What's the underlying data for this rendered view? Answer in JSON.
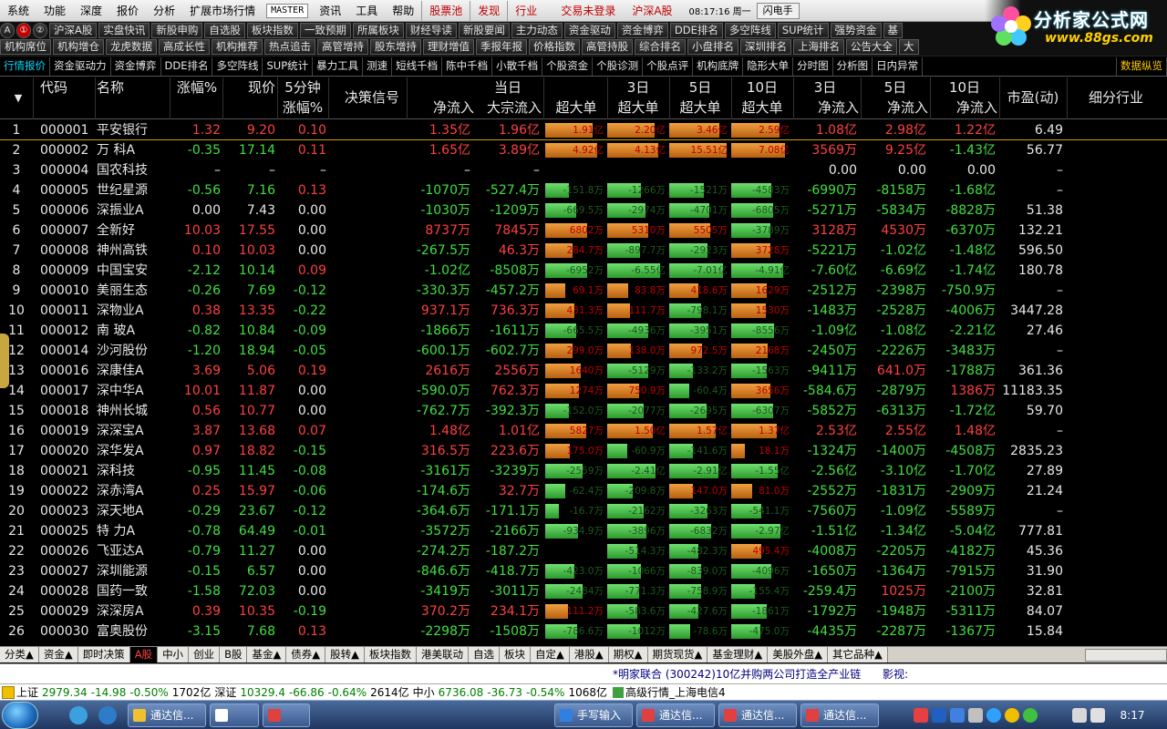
{
  "menubar": {
    "items": [
      "系统",
      "功能",
      "深度",
      "报价",
      "分析",
      "扩展市场行情"
    ],
    "master": "MASTER",
    "items2": [
      "资讯",
      "工具",
      "帮助"
    ],
    "items3": [
      "股票池",
      "发现",
      "行业"
    ],
    "status": "交易未登录",
    "market": "沪深A股",
    "time": "08:17:16 周一",
    "flash": "闪电手"
  },
  "logo": {
    "title": "分析家公式网",
    "url": "www.88gs.com"
  },
  "toolbar1": [
    "A",
    "①",
    "②",
    "沪深A股",
    "实盘快讯",
    "新股申购",
    "自选股",
    "板块指数",
    "一致预期",
    "所属板块",
    "财经导读",
    "新股要闻",
    "主力动态",
    "资金驱动",
    "资金博弈",
    "DDE排名",
    "多空阵线",
    "SUP统计",
    "强势资金",
    "基"
  ],
  "toolbar2": [
    "机构席位",
    "机构增仓",
    "龙虎数据",
    "高成长性",
    "机构推荐",
    "热点追击",
    "高管增持",
    "股东增持",
    "理财增值",
    "季报年报",
    "价格指数",
    "高管持股",
    "综合排名",
    "小盘排名",
    "深圳排名",
    "上海排名",
    "公告大全",
    "大"
  ],
  "tabs": [
    "行情报价",
    "资金驱动力",
    "资金博弈",
    "DDE排名",
    "多空阵线",
    "SUP统计",
    "暴力工具",
    "测速",
    "短线千档",
    "陈中千档",
    "小散千档",
    "个股资金",
    "个股诊测",
    "个股点评",
    "机构底牌",
    "隐形大单",
    "分时图",
    "分析图",
    "日内异常"
  ],
  "tabs_right": "数据纵览",
  "headers": {
    "code": "代码",
    "name": "名称",
    "pct": "涨幅%",
    "price": "现价",
    "m5a": "5分钟",
    "m5b": "涨幅%",
    "signal": "决策信号",
    "today": "当日",
    "net": "净流入",
    "block": "大宗流入",
    "super": "超大单",
    "d3": "3日",
    "d5": "5日",
    "d10": "10日",
    "pe": "市盈(动)",
    "industry": "细分行业"
  },
  "rows": [
    {
      "i": "1",
      "code": "000001",
      "name": "平安银行",
      "pct": "1.32",
      "price": "9.20",
      "m5": "0.10",
      "net": "1.35亿",
      "blk": "1.96亿",
      "s1": "1.91亿",
      "s3": "2.20亿",
      "s5": "3.46亿",
      "s10": "2.59亿",
      "n3": "1.08亿",
      "n5": "2.98亿",
      "n10": "1.22亿",
      "pe": "6.49"
    },
    {
      "i": "2",
      "code": "000002",
      "name": "万 科A",
      "pct": "-0.35",
      "price": "17.14",
      "m5": "0.11",
      "net": "1.65亿",
      "blk": "3.89亿",
      "s1": "4.92亿",
      "s3": "4.13亿",
      "s5": "15.51亿",
      "s10": "7.08亿",
      "n3": "3569万",
      "n5": "9.25亿",
      "n10": "-1.43亿",
      "pe": "56.77"
    },
    {
      "i": "3",
      "code": "000004",
      "name": "国农科技",
      "pct": "–",
      "price": "–",
      "m5": "–",
      "net": "–",
      "blk": "–",
      "s1": "",
      "s3": "",
      "s5": "",
      "s10": "",
      "n3": "0.00",
      "n5": "0.00",
      "n10": "0.00",
      "pe": "–"
    },
    {
      "i": "4",
      "code": "000005",
      "name": "世纪星源",
      "pct": "-0.56",
      "price": "7.16",
      "m5": "0.13",
      "net": "-1070万",
      "blk": "-527.4万",
      "s1": "-151.8万",
      "s3": "-1266万",
      "s5": "-1521万",
      "s10": "-4583万",
      "n3": "-6990万",
      "n5": "-8158万",
      "n10": "-1.68亿",
      "pe": "–"
    },
    {
      "i": "5",
      "code": "000006",
      "name": "深振业A",
      "pct": "0.00",
      "price": "7.43",
      "m5": "0.00",
      "net": "-1030万",
      "blk": "-1209万",
      "s1": "-669.5万",
      "s3": "-2974万",
      "s5": "-4701万",
      "s10": "-6805万",
      "n3": "-5271万",
      "n5": "-5834万",
      "n10": "-8828万",
      "pe": "51.38"
    },
    {
      "i": "6",
      "code": "000007",
      "name": "全新好",
      "pct": "10.03",
      "price": "17.55",
      "m5": "0.00",
      "net": "8737万",
      "blk": "7845万",
      "s1": "6802万",
      "s3": "5310万",
      "s5": "5505万",
      "s10": "-3789万",
      "n3": "3128万",
      "n5": "4530万",
      "n10": "-6370万",
      "pe": "132.21"
    },
    {
      "i": "7",
      "code": "000008",
      "name": "神州高铁",
      "pct": "0.10",
      "price": "10.03",
      "m5": "0.00",
      "net": "-267.5万",
      "blk": "46.3万",
      "s1": "284.7万",
      "s3": "-897.7万",
      "s5": "-2923万",
      "s10": "3728万",
      "n3": "-5221万",
      "n5": "-1.02亿",
      "n10": "-1.48亿",
      "pe": "596.50"
    },
    {
      "i": "8",
      "code": "000009",
      "name": "中国宝安",
      "pct": "-2.12",
      "price": "10.14",
      "m5": "0.09",
      "net": "-1.02亿",
      "blk": "-8508万",
      "s1": "-6952万",
      "s3": "-6.55亿",
      "s5": "-7.01亿",
      "s10": "-4.91亿",
      "n3": "-7.60亿",
      "n5": "-6.69亿",
      "n10": "-1.74亿",
      "pe": "180.78"
    },
    {
      "i": "9",
      "code": "000010",
      "name": "美丽生态",
      "pct": "-0.26",
      "price": "7.69",
      "m5": "-0.12",
      "net": "-330.3万",
      "blk": "-457.2万",
      "s1": "69.1万",
      "s3": "83.8万",
      "s5": "418.6万",
      "s10": "1629万",
      "n3": "-2512万",
      "n5": "-2398万",
      "n10": "-750.9万",
      "pe": "–"
    },
    {
      "i": "10",
      "code": "000011",
      "name": "深物业A",
      "pct": "0.38",
      "price": "13.35",
      "m5": "-0.22",
      "net": "937.1万",
      "blk": "736.3万",
      "s1": "431.3万",
      "s3": "111.7万",
      "s5": "-798.1万",
      "s10": "1530万",
      "n3": "-1483万",
      "n5": "-2528万",
      "n10": "-4006万",
      "pe": "3447.28"
    },
    {
      "i": "11",
      "code": "000012",
      "name": "南 玻A",
      "pct": "-0.82",
      "price": "10.84",
      "m5": "-0.09",
      "net": "-1866万",
      "blk": "-1611万",
      "s1": "-665.5万",
      "s3": "-4936万",
      "s5": "-3951万",
      "s10": "-8556万",
      "n3": "-1.09亿",
      "n5": "-1.08亿",
      "n10": "-2.21亿",
      "pe": "27.46"
    },
    {
      "i": "12",
      "code": "000014",
      "name": "沙河股份",
      "pct": "-1.20",
      "price": "18.94",
      "m5": "-0.05",
      "net": "-600.1万",
      "blk": "-602.7万",
      "s1": "299.0万",
      "s3": "138.0万",
      "s5": "972.5万",
      "s10": "2168万",
      "n3": "-2450万",
      "n5": "-2226万",
      "n10": "-3483万",
      "pe": "–"
    },
    {
      "i": "13",
      "code": "000016",
      "name": "深康佳A",
      "pct": "3.69",
      "price": "5.06",
      "m5": "0.19",
      "net": "2616万",
      "blk": "2556万",
      "s1": "1640万",
      "s3": "-5129万",
      "s5": "-133.2万",
      "s10": "-1563万",
      "n3": "-9411万",
      "n5": "641.0万",
      "n10": "-1788万",
      "pe": "361.36"
    },
    {
      "i": "14",
      "code": "000017",
      "name": "深中华A",
      "pct": "10.01",
      "price": "11.87",
      "m5": "0.00",
      "net": "-590.0万",
      "blk": "762.3万",
      "s1": "1274万",
      "s3": "750.9万",
      "s5": "-60.4万",
      "s10": "3656万",
      "n3": "-584.6万",
      "n5": "-2879万",
      "n10": "1386万",
      "pe": "11183.35"
    },
    {
      "i": "15",
      "code": "000018",
      "name": "神州长城",
      "pct": "0.56",
      "price": "10.77",
      "m5": "0.00",
      "net": "-762.7万",
      "blk": "-392.3万",
      "s1": "-152.0万",
      "s3": "-2077万",
      "s5": "-2695万",
      "s10": "-6307万",
      "n3": "-5852万",
      "n5": "-6313万",
      "n10": "-1.72亿",
      "pe": "59.70"
    },
    {
      "i": "16",
      "code": "000019",
      "name": "深深宝A",
      "pct": "3.87",
      "price": "13.68",
      "m5": "0.07",
      "net": "1.48亿",
      "blk": "1.01亿",
      "s1": "5827万",
      "s3": "1.50亿",
      "s5": "1.57亿",
      "s10": "1.37亿",
      "n3": "2.53亿",
      "n5": "2.55亿",
      "n10": "1.48亿",
      "pe": "–"
    },
    {
      "i": "17",
      "code": "000020",
      "name": "深华发A",
      "pct": "0.97",
      "price": "18.82",
      "m5": "-0.15",
      "net": "316.5万",
      "blk": "223.6万",
      "s1": "175.0万",
      "s3": "-60.9万",
      "s5": "-141.6万",
      "s10": "18.1万",
      "n3": "-1324万",
      "n5": "-1400万",
      "n10": "-4508万",
      "pe": "2835.23"
    },
    {
      "i": "18",
      "code": "000021",
      "name": "深科技",
      "pct": "-0.95",
      "price": "11.45",
      "m5": "-0.08",
      "net": "-3161万",
      "blk": "-3239万",
      "s1": "-2559万",
      "s3": "-2.41亿",
      "s5": "-2.91亿",
      "s10": "-1.55亿",
      "n3": "-2.56亿",
      "n5": "-3.10亿",
      "n10": "-1.70亿",
      "pe": "27.89"
    },
    {
      "i": "19",
      "code": "000022",
      "name": "深赤湾A",
      "pct": "0.25",
      "price": "15.97",
      "m5": "-0.06",
      "net": "-174.6万",
      "blk": "32.7万",
      "s1": "-62.4万",
      "s3": "-209.8万",
      "s5": "147.0万",
      "s10": "81.0万",
      "n3": "-2552万",
      "n5": "-1831万",
      "n10": "-2909万",
      "pe": "21.24"
    },
    {
      "i": "20",
      "code": "000023",
      "name": "深天地A",
      "pct": "-0.29",
      "price": "23.67",
      "m5": "-0.12",
      "net": "-364.6万",
      "blk": "-171.1万",
      "s1": "-16.7万",
      "s3": "-2162万",
      "s5": "-3263万",
      "s10": "-541.1万",
      "n3": "-7560万",
      "n5": "-1.09亿",
      "n10": "-5589万",
      "pe": "–"
    },
    {
      "i": "21",
      "code": "000025",
      "name": "特 力A",
      "pct": "-0.78",
      "price": "64.49",
      "m5": "-0.01",
      "net": "-3572万",
      "blk": "-2166万",
      "s1": "-934.9万",
      "s3": "-3896万",
      "s5": "-6832万",
      "s10": "-2.97亿",
      "n3": "-1.51亿",
      "n5": "-1.34亿",
      "n10": "-5.04亿",
      "pe": "777.81"
    },
    {
      "i": "22",
      "code": "000026",
      "name": "飞亚达A",
      "pct": "-0.79",
      "price": "11.27",
      "m5": "0.00",
      "net": "-274.2万",
      "blk": "-187.2万",
      "s1": "",
      "s3": "-514.3万",
      "s5": "-482.3万",
      "s10": "495.4万",
      "n3": "-4008万",
      "n5": "-2205万",
      "n10": "-4182万",
      "pe": "45.36"
    },
    {
      "i": "23",
      "code": "000027",
      "name": "深圳能源",
      "pct": "-0.15",
      "price": "6.57",
      "m5": "0.00",
      "net": "-846.6万",
      "blk": "-418.7万",
      "s1": "-423.0万",
      "s3": "-1066万",
      "s5": "-839.0万",
      "s10": "-4096万",
      "n3": "-1650万",
      "n5": "-1364万",
      "n10": "-7915万",
      "pe": "31.90"
    },
    {
      "i": "24",
      "code": "000028",
      "name": "国药一致",
      "pct": "-1.58",
      "price": "72.03",
      "m5": "0.00",
      "net": "-3419万",
      "blk": "-3011万",
      "s1": "-2484万",
      "s3": "-771.3万",
      "s5": "-758.9万",
      "s10": "-155.4万",
      "n3": "-259.4万",
      "n5": "1025万",
      "n10": "-2100万",
      "pe": "32.81"
    },
    {
      "i": "25",
      "code": "000029",
      "name": "深深房A",
      "pct": "0.39",
      "price": "10.35",
      "m5": "-0.19",
      "net": "370.2万",
      "blk": "234.1万",
      "s1": "111.2万",
      "s3": "-583.6万",
      "s5": "-427.6万",
      "s10": "-1861万",
      "n3": "-1792万",
      "n5": "-1948万",
      "n10": "-5311万",
      "pe": "84.07"
    },
    {
      "i": "26",
      "code": "000030",
      "name": "富奥股份",
      "pct": "-3.15",
      "price": "7.68",
      "m5": "0.13",
      "net": "-2298万",
      "blk": "-1508万",
      "s1": "-786.6万",
      "s3": "-1012万",
      "s5": "-78.6万",
      "s10": "-475.0万",
      "n3": "-4435万",
      "n5": "-2287万",
      "n10": "-1367万",
      "pe": "15.84"
    }
  ],
  "bottom_tabs": [
    "分类▲",
    "资金▲",
    "即时决策",
    "A股",
    "中小",
    "创业",
    "B股",
    "基金▲",
    "债券▲",
    "股转▲",
    "板块指数",
    "港美联动",
    "自选",
    "板块",
    "自定▲",
    "港股▲",
    "期权▲",
    "期货现货▲",
    "基金理财▲",
    "美股外盘▲",
    "其它品种▲"
  ],
  "news": {
    "text": "*明家联合 (300242)10亿并购两公司打造全产业链",
    "right": "影视:"
  },
  "index": {
    "sh_label": "上证",
    "sh_val": "2979.34",
    "sh_chg": "-14.98",
    "sh_pct": "-0.50%",
    "sh_amt": "1702亿",
    "sz_label": "深证",
    "sz_val": "10329.4",
    "sz_chg": "-66.86",
    "sz_pct": "-0.64%",
    "sz_amt": "2614亿",
    "zx_label": "中小",
    "zx_val": "6736.08",
    "zx_chg": "-36.73",
    "zx_pct": "-0.54%",
    "zx_amt": "1068亿",
    "source": "高级行情_上海电信4"
  },
  "taskbar": {
    "tasks": [
      "通达信...",
      "",
      "",
      "手写输入",
      "通达信...",
      "通达信...",
      "通达信..."
    ],
    "clock": "8:17"
  },
  "colors": {
    "up": "#ff4040",
    "down": "#40e040",
    "bar_pos": "#e08a30",
    "bar_neg": "#50c850"
  }
}
